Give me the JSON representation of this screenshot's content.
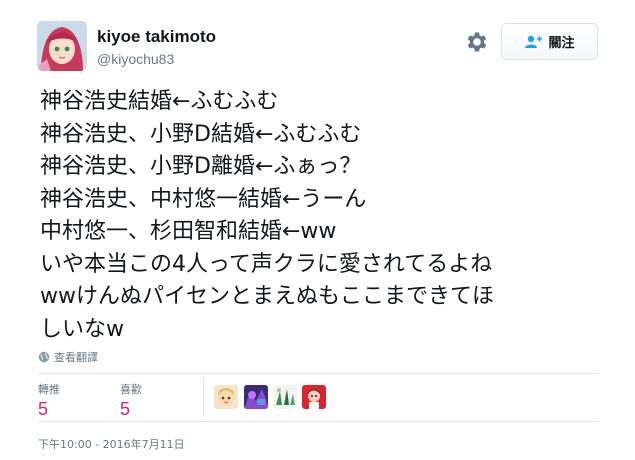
{
  "user": {
    "name": "kiyoe takimoto",
    "handle": "@kiyochu83"
  },
  "follow_button": {
    "label": "關注"
  },
  "tweet": {
    "lines": [
      "神谷浩史結婚←ふむふむ",
      "神谷浩史、小野D結婚←ふむふむ",
      "神谷浩史、小野D離婚←ふぁっ？",
      "神谷浩史、中村悠一結婚←うーん",
      "中村悠一、杉田智和結婚←ww",
      "いや本当この4人って声クラに愛されてるよね",
      "wwけんぬパイセンとまえぬもここまできてほ",
      "しいなw"
    ]
  },
  "translate": {
    "label": "查看翻譯"
  },
  "stats": {
    "retweets": {
      "label": "轉推",
      "value": "5"
    },
    "likes": {
      "label": "喜歡",
      "value": "5"
    }
  },
  "timestamp": "下午10:00 - 2016年7月11日",
  "icons": {
    "settings": "gear-icon",
    "follow": "add-user-icon",
    "translate": "globe-icon"
  },
  "colors": {
    "stat_value": "#e0245e",
    "muted_text": "#657786",
    "text": "#14171a"
  }
}
